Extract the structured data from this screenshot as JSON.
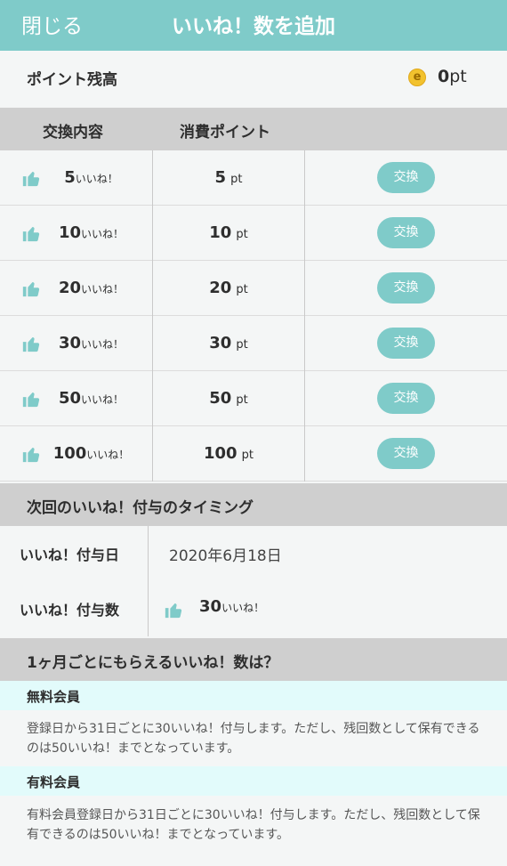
{
  "header": {
    "close_label": "閉じる",
    "title": "いいね！数を追加"
  },
  "balance": {
    "label": "ポイント残高",
    "coin_letter": "e",
    "value": "0",
    "unit": "pt"
  },
  "table": {
    "headers": [
      "交換内容",
      "消費ポイント"
    ],
    "rows": [
      {
        "likes": "5",
        "like_unit": "いいね！",
        "cost": "5",
        "cost_unit": "pt",
        "button": "交換"
      },
      {
        "likes": "10",
        "like_unit": "いいね！",
        "cost": "10",
        "cost_unit": "pt",
        "button": "交換"
      },
      {
        "likes": "20",
        "like_unit": "いいね！",
        "cost": "20",
        "cost_unit": "pt",
        "button": "交換"
      },
      {
        "likes": "30",
        "like_unit": "いいね！",
        "cost": "30",
        "cost_unit": "pt",
        "button": "交換"
      },
      {
        "likes": "50",
        "like_unit": "いいね！",
        "cost": "50",
        "cost_unit": "pt",
        "button": "交換"
      },
      {
        "likes": "100",
        "like_unit": "いいね！",
        "cost": "100",
        "cost_unit": "pt",
        "button": "交換"
      }
    ]
  },
  "next_grant": {
    "title": "次回のいいね！付与のタイミング",
    "date_label": "いいね！付与日",
    "date_value": "2020年6月18日",
    "count_label": "いいね！付与数",
    "count_value": "30",
    "count_unit": "いいね！"
  },
  "monthly": {
    "title": "1ヶ月ごとにもらえるいいね！数は？",
    "free": {
      "label": "無料会員",
      "text": "登録日から31日ごとに30いいね！付与します。ただし、残回数として保有できるのは50いいね！までとなっています。"
    },
    "paid": {
      "label": "有料会員",
      "text": "有料会員登録日から31日ごとに30いいね！付与します。ただし、残回数として保有できるのは50いいね！までとなっています。"
    }
  },
  "colors": {
    "accent": "#7fcbc9",
    "section_bg": "#cfcfcf",
    "member_bg": "#e2fbfb",
    "coin": "#f2c22e"
  },
  "icons": {
    "like": "thumbs-up-icon",
    "coin": "coin-icon"
  }
}
